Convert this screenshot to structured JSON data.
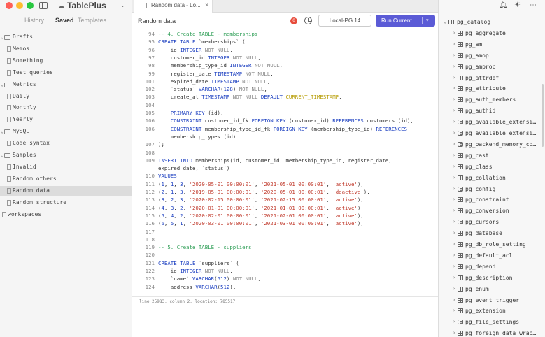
{
  "app": {
    "name": "TablePlus"
  },
  "window_controls": {
    "close": "#fe5f57",
    "minimize": "#febc2e",
    "maximize": "#28c840"
  },
  "sidebar": {
    "tabs": [
      "History",
      "Saved",
      "Templates"
    ],
    "active_tab": "Saved",
    "tree": [
      {
        "type": "folder",
        "label": "Drafts",
        "expanded": true,
        "level": 0
      },
      {
        "type": "file",
        "label": "Memos",
        "level": 1
      },
      {
        "type": "file",
        "label": "Something",
        "level": 1
      },
      {
        "type": "file",
        "label": "Test queries",
        "level": 1
      },
      {
        "type": "folder",
        "label": "Metrics",
        "expanded": true,
        "level": 0
      },
      {
        "type": "file",
        "label": "Daily",
        "level": 1
      },
      {
        "type": "file",
        "label": "Monthly",
        "level": 1
      },
      {
        "type": "file",
        "label": "Yearly",
        "level": 1
      },
      {
        "type": "folder",
        "label": "MySQL",
        "expanded": true,
        "level": 0
      },
      {
        "type": "file",
        "label": "Code syntax",
        "level": 1
      },
      {
        "type": "folder",
        "label": "Samples",
        "expanded": true,
        "level": 0
      },
      {
        "type": "file",
        "label": "Invalid",
        "level": 1
      },
      {
        "type": "file",
        "label": "Random others",
        "level": 1
      },
      {
        "type": "file",
        "label": "Random data",
        "level": 1,
        "selected": true
      },
      {
        "type": "file",
        "label": "Random structure",
        "level": 1
      },
      {
        "type": "file",
        "label": "workspaces",
        "level": 0
      }
    ]
  },
  "tabbar": {
    "tab_label": "Random data - Lo...",
    "close": "×"
  },
  "toolbar": {
    "title": "Random data",
    "record_badge": "0",
    "connection": "Local-PG 14",
    "run_label": "Run Current",
    "run_chevron": "▾"
  },
  "editor": {
    "lines": [
      {
        "n": "94",
        "c": [
          [
            "cm",
            "-- 4. Create TABLE - memberships"
          ]
        ]
      },
      {
        "n": "95",
        "c": [
          [
            "kw",
            "CREATE TABLE"
          ],
          [
            "",
            " `memberships` ("
          ]
        ]
      },
      {
        "n": "96",
        "c": [
          [
            "",
            "    id "
          ],
          [
            "kw",
            "INTEGER"
          ],
          [
            "gry",
            " NOT NULL"
          ],
          [
            "",
            ","
          ]
        ]
      },
      {
        "n": "97",
        "c": [
          [
            "",
            "    customer_id "
          ],
          [
            "kw",
            "INTEGER"
          ],
          [
            "gry",
            " NOT NULL"
          ],
          [
            "",
            ","
          ]
        ]
      },
      {
        "n": "98",
        "c": [
          [
            "",
            "    membership_type_id "
          ],
          [
            "kw",
            "INTEGER"
          ],
          [
            "gry",
            " NOT NULL"
          ],
          [
            "",
            ","
          ]
        ]
      },
      {
        "n": "99",
        "c": [
          [
            "",
            "    register_date "
          ],
          [
            "kw",
            "TIMESTAMP"
          ],
          [
            "gry",
            " NOT NULL"
          ],
          [
            "",
            ","
          ]
        ]
      },
      {
        "n": "101",
        "c": [
          [
            "",
            "    expired_date "
          ],
          [
            "kw",
            "TIMESTAMP"
          ],
          [
            "gry",
            " NOT NULL"
          ],
          [
            "",
            ","
          ]
        ]
      },
      {
        "n": "102",
        "c": [
          [
            "",
            "    `status` "
          ],
          [
            "kw",
            "VARCHAR"
          ],
          [
            "",
            "("
          ],
          [
            "num",
            "128"
          ],
          [
            "",
            ")"
          ],
          [
            "gry",
            " NOT NULL"
          ],
          [
            "",
            ","
          ]
        ]
      },
      {
        "n": "103",
        "c": [
          [
            "",
            "    create_at "
          ],
          [
            "kw",
            "TIMESTAMP"
          ],
          [
            "gry",
            " NOT NULL"
          ],
          [
            "kw",
            " DEFAULT"
          ],
          [
            "fn",
            " CURRENT_TIMESTAMP"
          ],
          [
            "",
            ","
          ]
        ]
      },
      {
        "n": "104",
        "c": []
      },
      {
        "n": "105",
        "c": [
          [
            "kw",
            "    PRIMARY KEY"
          ],
          [
            "",
            " (id),"
          ]
        ]
      },
      {
        "n": "106",
        "c": [
          [
            "kw",
            "    CONSTRAINT"
          ],
          [
            "",
            " customer_id_fk "
          ],
          [
            "kw",
            "FOREIGN KEY"
          ],
          [
            "",
            " (customer_id) "
          ],
          [
            "kw",
            "REFERENCES"
          ],
          [
            "",
            " customers (id),"
          ]
        ]
      },
      {
        "n": "106",
        "c": [
          [
            "kw",
            "    CONSTRAINT"
          ],
          [
            "",
            " membership_type_id_fk "
          ],
          [
            "kw",
            "FOREIGN KEY"
          ],
          [
            "",
            " (membership_type_id) "
          ],
          [
            "kw",
            "REFERENCES"
          ]
        ]
      },
      {
        "n": "",
        "c": [
          [
            "",
            "    membership_types (id)"
          ]
        ]
      },
      {
        "n": "107",
        "c": [
          [
            "",
            ");"
          ]
        ]
      },
      {
        "n": "108",
        "c": []
      },
      {
        "n": "109",
        "c": [
          [
            "kw",
            "INSERT INTO"
          ],
          [
            "",
            " memberships(id, customer_id, membership_type_id, register_date,"
          ]
        ]
      },
      {
        "n": "",
        "c": [
          [
            "",
            "expired_date, `status`)"
          ]
        ]
      },
      {
        "n": "110",
        "c": [
          [
            "kw",
            "VALUES"
          ]
        ]
      },
      {
        "n": "111",
        "c": [
          [
            "",
            "("
          ],
          [
            "num",
            "1"
          ],
          [
            "",
            ", "
          ],
          [
            "num",
            "1"
          ],
          [
            "",
            ", "
          ],
          [
            "num",
            "3"
          ],
          [
            "",
            ", "
          ],
          [
            "str",
            "'2020-05-01 00:00:01'"
          ],
          [
            "",
            ", "
          ],
          [
            "str",
            "'2021-05-01 00:00:01'"
          ],
          [
            "",
            ", "
          ],
          [
            "str",
            "'active'"
          ],
          [
            "",
            "),"
          ]
        ]
      },
      {
        "n": "112",
        "c": [
          [
            "",
            "("
          ],
          [
            "num",
            "2"
          ],
          [
            "",
            ", "
          ],
          [
            "num",
            "1"
          ],
          [
            "",
            ", "
          ],
          [
            "num",
            "3"
          ],
          [
            "",
            ", "
          ],
          [
            "str",
            "'2019-05-01 00:00:01'"
          ],
          [
            "",
            ", "
          ],
          [
            "str",
            "'2020-05-01 00:00:01'"
          ],
          [
            "",
            ", "
          ],
          [
            "str",
            "'deactive'"
          ],
          [
            "",
            "),"
          ]
        ]
      },
      {
        "n": "113",
        "c": [
          [
            "",
            "("
          ],
          [
            "num",
            "3"
          ],
          [
            "",
            ", "
          ],
          [
            "num",
            "2"
          ],
          [
            "",
            ", "
          ],
          [
            "num",
            "3"
          ],
          [
            "",
            ", "
          ],
          [
            "str",
            "'2020-02-15 00:00:01'"
          ],
          [
            "",
            ", "
          ],
          [
            "str",
            "'2021-02-15 00:00:01'"
          ],
          [
            "",
            ", "
          ],
          [
            "str",
            "'active'"
          ],
          [
            "",
            "),"
          ]
        ]
      },
      {
        "n": "114",
        "c": [
          [
            "",
            "("
          ],
          [
            "num",
            "4"
          ],
          [
            "",
            ", "
          ],
          [
            "num",
            "3"
          ],
          [
            "",
            ", "
          ],
          [
            "num",
            "2"
          ],
          [
            "",
            ", "
          ],
          [
            "str",
            "'2020-01-01 00:00:01'"
          ],
          [
            "",
            ", "
          ],
          [
            "str",
            "'2021-01-01 00:00:01'"
          ],
          [
            "",
            ", "
          ],
          [
            "str",
            "'active'"
          ],
          [
            "",
            "),"
          ]
        ]
      },
      {
        "n": "115",
        "c": [
          [
            "",
            "("
          ],
          [
            "num",
            "5"
          ],
          [
            "",
            ", "
          ],
          [
            "num",
            "4"
          ],
          [
            "",
            ", "
          ],
          [
            "num",
            "2"
          ],
          [
            "",
            ", "
          ],
          [
            "str",
            "'2020-02-01 00:00:01'"
          ],
          [
            "",
            ", "
          ],
          [
            "str",
            "'2021-02-01 00:00:01'"
          ],
          [
            "",
            ", "
          ],
          [
            "str",
            "'active'"
          ],
          [
            "",
            "),"
          ]
        ]
      },
      {
        "n": "116",
        "c": [
          [
            "",
            "("
          ],
          [
            "num",
            "6"
          ],
          [
            "",
            ", "
          ],
          [
            "num",
            "5"
          ],
          [
            "",
            ", "
          ],
          [
            "num",
            "1"
          ],
          [
            "",
            ", "
          ],
          [
            "str",
            "'2020-03-01 00:00:01'"
          ],
          [
            "",
            ", "
          ],
          [
            "str",
            "'2021-03-01 00:00:01'"
          ],
          [
            "",
            ", "
          ],
          [
            "str",
            "'active'"
          ],
          [
            "",
            ");"
          ]
        ]
      },
      {
        "n": "117",
        "c": []
      },
      {
        "n": "118",
        "c": []
      },
      {
        "n": "119",
        "c": [
          [
            "cm",
            "-- 5. Create TABLE - suppliers"
          ]
        ]
      },
      {
        "n": "120",
        "c": []
      },
      {
        "n": "121",
        "c": [
          [
            "kw",
            "CREATE TABLE"
          ],
          [
            "",
            " `suppliers` ("
          ]
        ]
      },
      {
        "n": "122",
        "c": [
          [
            "",
            "    id "
          ],
          [
            "kw",
            "INTEGER"
          ],
          [
            "gry",
            " NOT NULL"
          ],
          [
            "",
            ","
          ]
        ]
      },
      {
        "n": "123",
        "c": [
          [
            "",
            "    `name` "
          ],
          [
            "kw",
            "VARCHAR"
          ],
          [
            "",
            "("
          ],
          [
            "num",
            "512"
          ],
          [
            "",
            ")"
          ],
          [
            "gry",
            " NOT NULL"
          ],
          [
            "",
            ","
          ]
        ]
      },
      {
        "n": "124",
        "c": [
          [
            "",
            "    address "
          ],
          [
            "kw",
            "VARCHAR"
          ],
          [
            "",
            "("
          ],
          [
            "num",
            "512"
          ],
          [
            "",
            "),"
          ]
        ]
      }
    ]
  },
  "status": {
    "text": "line 25983, column 2, location: 785517"
  },
  "objects": [
    {
      "label": "pg_catalog",
      "kind": "schema",
      "expanded": true
    },
    {
      "label": "pg_aggregate",
      "kind": "table"
    },
    {
      "label": "pg_am",
      "kind": "table"
    },
    {
      "label": "pg_amop",
      "kind": "table"
    },
    {
      "label": "pg_amproc",
      "kind": "table"
    },
    {
      "label": "pg_attrdef",
      "kind": "table"
    },
    {
      "label": "pg_attribute",
      "kind": "table"
    },
    {
      "label": "pg_auth_members",
      "kind": "table"
    },
    {
      "label": "pg_authid",
      "kind": "table"
    },
    {
      "label": "pg_available_extensi…",
      "kind": "view"
    },
    {
      "label": "pg_available_extensi…",
      "kind": "view"
    },
    {
      "label": "pg_backend_memory_co…",
      "kind": "view"
    },
    {
      "label": "pg_cast",
      "kind": "table"
    },
    {
      "label": "pg_class",
      "kind": "table"
    },
    {
      "label": "pg_collation",
      "kind": "table"
    },
    {
      "label": "pg_config",
      "kind": "view"
    },
    {
      "label": "pg_constraint",
      "kind": "table"
    },
    {
      "label": "pg_conversion",
      "kind": "table"
    },
    {
      "label": "pg_cursors",
      "kind": "view"
    },
    {
      "label": "pg_database",
      "kind": "table"
    },
    {
      "label": "pg_db_role_setting",
      "kind": "table"
    },
    {
      "label": "pg_default_acl",
      "kind": "table"
    },
    {
      "label": "pg_depend",
      "kind": "table"
    },
    {
      "label": "pg_description",
      "kind": "table"
    },
    {
      "label": "pg_enum",
      "kind": "table"
    },
    {
      "label": "pg_event_trigger",
      "kind": "table"
    },
    {
      "label": "pg_extension",
      "kind": "table"
    },
    {
      "label": "pg_file_settings",
      "kind": "view"
    },
    {
      "label": "pg_foreign_data_wrap…",
      "kind": "table"
    }
  ]
}
